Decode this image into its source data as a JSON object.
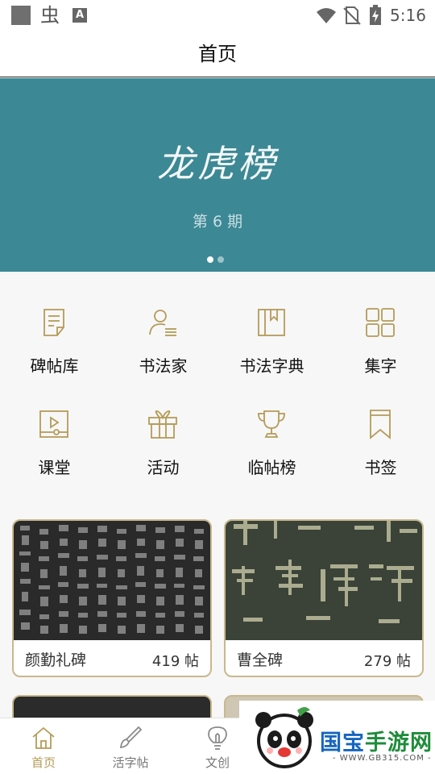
{
  "status_bar": {
    "time": "5:16",
    "app_glyph": "虫",
    "a_badge": "A"
  },
  "header": {
    "title": "首页"
  },
  "banner": {
    "title": "龙虎榜",
    "subtitle": "第 6 期",
    "page_count": 2,
    "active_page": 1
  },
  "menu": {
    "items": [
      {
        "label": "碑帖库",
        "icon": "document-icon"
      },
      {
        "label": "书法家",
        "icon": "person-list-icon"
      },
      {
        "label": "书法字典",
        "icon": "book-icon"
      },
      {
        "label": "集字",
        "icon": "grid-icon"
      },
      {
        "label": "课堂",
        "icon": "video-lesson-icon"
      },
      {
        "label": "活动",
        "icon": "gift-icon"
      },
      {
        "label": "临帖榜",
        "icon": "trophy-icon"
      },
      {
        "label": "书签",
        "icon": "bookmark-icon"
      }
    ]
  },
  "cards": [
    {
      "name": "颜勤礼碑",
      "count": "419 帖"
    },
    {
      "name": "曹全碑",
      "count": "279 帖"
    }
  ],
  "tabbar": {
    "tabs": [
      {
        "label": "首页",
        "icon": "home-icon",
        "active": true
      },
      {
        "label": "活字帖",
        "icon": "brush-icon",
        "active": false
      },
      {
        "label": "文创",
        "icon": "lightbulb-icon",
        "active": false
      }
    ]
  },
  "watermark": {
    "brand_a": "国宝",
    "brand_b": "手游网",
    "url": "- WWW.GB315.COM -"
  },
  "colors": {
    "banner": "#3c8895",
    "accent": "#b59b58",
    "card_border": "#c8b88e"
  }
}
